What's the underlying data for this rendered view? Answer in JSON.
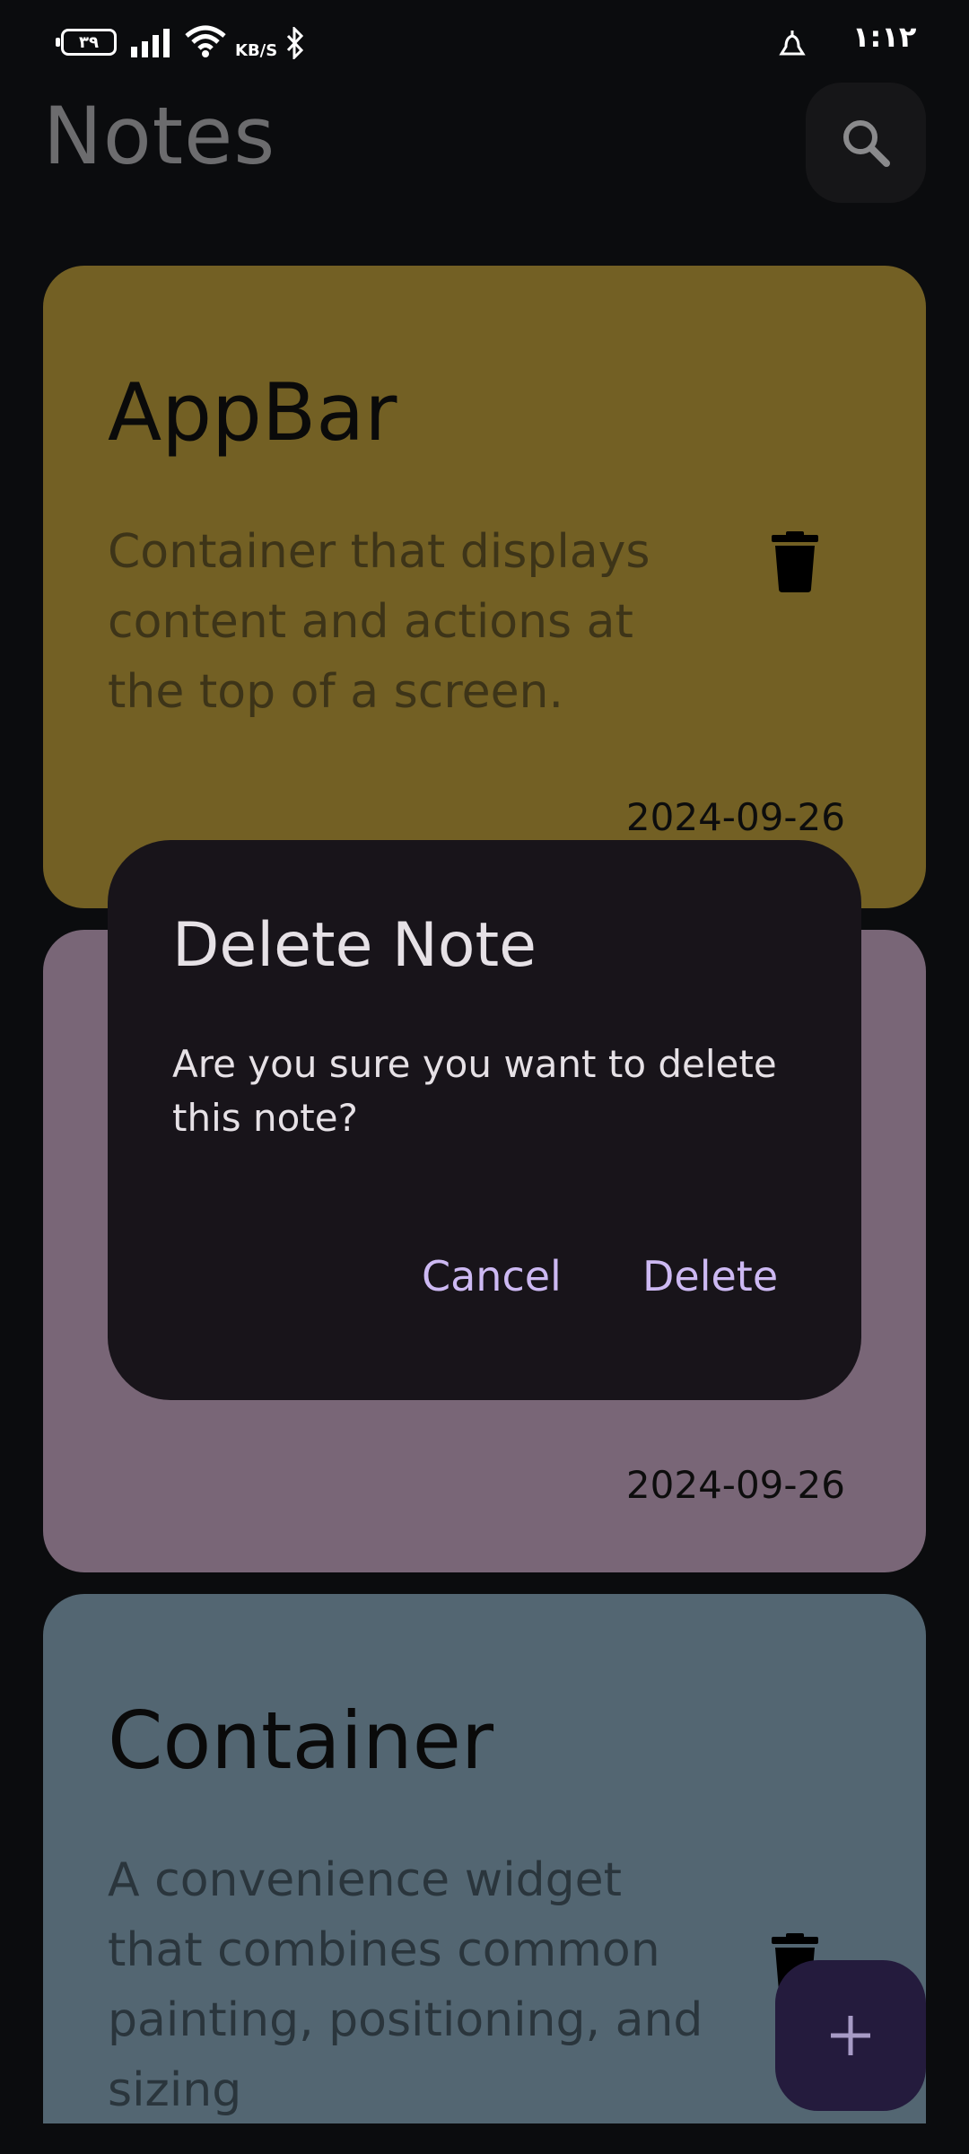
{
  "status_bar": {
    "battery": "۳۹",
    "speed_unit": "KB/S",
    "time": "۱:۱۲"
  },
  "app_bar": {
    "title": "Notes",
    "search_icon": "search-icon"
  },
  "notes": [
    {
      "title": "AppBar",
      "body": "Container that displays content and actions at the top of a screen.",
      "date": "2024-09-26",
      "color": "#736024"
    },
    {
      "title": "",
      "body": "",
      "date": "2024-09-26",
      "color": "#796677"
    },
    {
      "title": "Container",
      "body": "A convenience widget that combines common painting, positioning, and sizing",
      "date": "",
      "color": "#536672"
    }
  ],
  "dialog": {
    "title": "Delete Note",
    "message": "Are you sure you want to delete this note?",
    "cancel_label": "Cancel",
    "delete_label": "Delete"
  },
  "fab": {
    "icon": "plus-icon"
  },
  "colors": {
    "accent": "#cdb9f3",
    "dialog_bg": "#18141a",
    "fab_bg": "#241b3d"
  }
}
